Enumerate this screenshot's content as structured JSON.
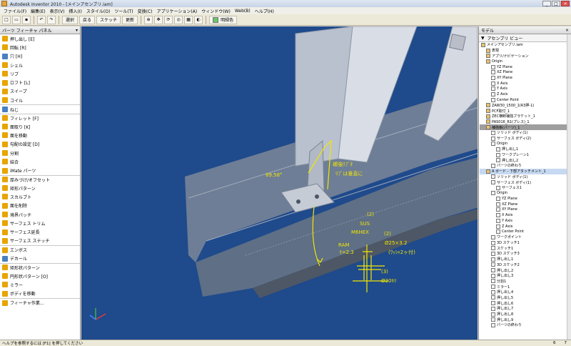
{
  "window": {
    "title": "Autodesk Inventor 2010 - [メインアセンブリ.iam]",
    "buttons": [
      "_",
      "□",
      "×"
    ]
  },
  "menu": [
    "ファイル(F)",
    "編集(E)",
    "表示(V)",
    "挿入(I)",
    "スタイル(O)",
    "ツール(T)",
    "変換(C)",
    "アプリケーション(A)",
    "ウィンドウ(W)",
    "Web(B)",
    "ヘルプ(H)"
  ],
  "toolbar": {
    "select_label": "選択",
    "back_label": "戻る",
    "sketch_label": "スケッチ",
    "update_label": "更新",
    "color_label": "明緑色"
  },
  "left_panel": {
    "title": "パーツ フィーチャ パネル",
    "tools": [
      {
        "label": "押し出し  [E]",
        "color": "#e8a400"
      },
      {
        "label": "回転  [R]",
        "color": "#e8a400"
      },
      {
        "label": "穴  [H]",
        "color": "#4a7fc1"
      },
      {
        "label": "シェル",
        "color": "#e8a400"
      },
      {
        "label": "リブ",
        "color": "#e8a400"
      },
      {
        "label": "ロフト  [L]",
        "color": "#e8a400"
      },
      {
        "label": "スイープ",
        "color": "#e8a400"
      },
      {
        "label": "コイル",
        "color": "#e8a400"
      },
      {
        "label": "ねじ",
        "color": "#4a7fc1"
      },
      {
        "label": "フィレット  [F]",
        "color": "#e8a400"
      },
      {
        "label": "面取り  [K]",
        "color": "#e8a400"
      },
      {
        "label": "面を移動",
        "color": "#e8a400"
      },
      {
        "label": "勾配の設定  [D]",
        "color": "#e8a400"
      },
      {
        "label": "分割",
        "color": "#e8a400"
      },
      {
        "label": "結合",
        "color": "#e8a400"
      },
      {
        "label": "iMate パーツ",
        "color": "#e8a400"
      },
      {
        "label": "厚みづけ/オフセット",
        "color": "#e8a400"
      },
      {
        "label": "矩形パターン",
        "color": "#e8a400"
      },
      {
        "label": "スカルプト",
        "color": "#e8a400"
      },
      {
        "label": "面を削除",
        "color": "#e8a400"
      },
      {
        "label": "境界パッチ",
        "color": "#e8a400"
      },
      {
        "label": "サーフェス トリム",
        "color": "#e8a400"
      },
      {
        "label": "サーフェス延長",
        "color": "#e8a400"
      },
      {
        "label": "サーフェス ステッチ",
        "color": "#e8a400"
      },
      {
        "label": "エンボス",
        "color": "#e8a400"
      },
      {
        "label": "デカール",
        "color": "#4a7fc1"
      },
      {
        "label": "矩形状パターン",
        "color": "#e8a400"
      },
      {
        "label": "円形状パターン  [O]",
        "color": "#e8a400"
      },
      {
        "label": "ミラー",
        "color": "#e8a400"
      },
      {
        "label": "ボディを移動",
        "color": "#e8a400"
      },
      {
        "label": "フィーチャ作業...",
        "color": "#e8a400"
      }
    ]
  },
  "right_panel": {
    "title": "モデル",
    "view_label": "アセンブリ ビュー",
    "tree": [
      {
        "label": "メインアセンブリ.iam",
        "indent": 0
      },
      {
        "label": "表現",
        "indent": 1
      },
      {
        "label": "アプリ/ナビゲーション",
        "indent": 1
      },
      {
        "label": "Origin",
        "indent": 1
      },
      {
        "label": "YZ Plane",
        "indent": 2
      },
      {
        "label": "XZ Plane",
        "indent": 2
      },
      {
        "label": "XY Plane",
        "indent": 2
      },
      {
        "label": "X Axis",
        "indent": 2
      },
      {
        "label": "Y Axis",
        "indent": 2
      },
      {
        "label": "Z Axis",
        "indent": 2
      },
      {
        "label": "Center Point",
        "indent": 2
      },
      {
        "label": "ZAW30_1500_1(R3押-1)",
        "indent": 1
      },
      {
        "label": "PCF取付_1",
        "indent": 1
      },
      {
        "label": "ZEC横断補強ブラケット_1",
        "indent": 1
      },
      {
        "label": "PAS016_R1(プレス)_1",
        "indent": 1
      },
      {
        "label": "補強板(パーツ)_1",
        "indent": 1
      },
      {
        "label": "ソリッド ボディ(1)",
        "indent": 2
      },
      {
        "label": "サーフェス ボディ(2)",
        "indent": 2
      },
      {
        "label": "Origin",
        "indent": 2
      },
      {
        "label": "押し出し1",
        "indent": 3
      },
      {
        "label": "ワークプレーン1",
        "indent": 3
      },
      {
        "label": "押し出し2",
        "indent": 3
      },
      {
        "label": "パーツの終わり",
        "indent": 2
      },
      {
        "label": "A ボード - 下部アタッチメント_1",
        "indent": 1
      },
      {
        "label": "ソリッド ボディ(1)",
        "indent": 2
      },
      {
        "label": "サーフェス ボディ(1)",
        "indent": 2
      },
      {
        "label": "サーフェス1",
        "indent": 3
      },
      {
        "label": "Origin",
        "indent": 2
      },
      {
        "label": "YZ Plane",
        "indent": 3
      },
      {
        "label": "XZ Plane",
        "indent": 3
      },
      {
        "label": "XY Plane",
        "indent": 3
      },
      {
        "label": "X Axis",
        "indent": 3
      },
      {
        "label": "Y Axis",
        "indent": 3
      },
      {
        "label": "Z Axis",
        "indent": 3
      },
      {
        "label": "Center Point",
        "indent": 3
      },
      {
        "label": "ワークポイント",
        "indent": 2
      },
      {
        "label": "3D スケッチ1",
        "indent": 2
      },
      {
        "label": "スケッチ1",
        "indent": 2
      },
      {
        "label": "3D スケッチ3",
        "indent": 2
      },
      {
        "label": "押し出し1",
        "indent": 2
      },
      {
        "label": "3D スケッチ2",
        "indent": 2
      },
      {
        "label": "押し出し2",
        "indent": 2
      },
      {
        "label": "押し出し3",
        "indent": 2
      },
      {
        "label": "分割1",
        "indent": 2
      },
      {
        "label": "ミラー1",
        "indent": 2
      },
      {
        "label": "押し出し4",
        "indent": 2
      },
      {
        "label": "押し出し5",
        "indent": 2
      },
      {
        "label": "押し出し6",
        "indent": 2
      },
      {
        "label": "押し出し7",
        "indent": 2
      },
      {
        "label": "押し出し8",
        "indent": 2
      },
      {
        "label": "押し出し9",
        "indent": 2
      },
      {
        "label": "パーツの終わり",
        "indent": 2
      }
    ]
  },
  "annotations": {
    "angle": "89.58°",
    "rib_note_1": "補強ﾘﾌﾞﾀ",
    "rib_note_2": "ﾘﾌﾞは垂直に",
    "bolt": "M6HEX",
    "sus": "SUS",
    "plate": "Ø25×3.2",
    "washer_note": "(ﾜｯｼｬ2ヶ付)",
    "hole": "Ø20ｷﾘ",
    "ram": "RAM",
    "t23": "t=2.3",
    "qty": "(2)",
    "qty2": "(2)",
    "qty3": "(3)"
  },
  "status": {
    "help": "ヘルプを参照するには [F1] を押してください",
    "num1": "6",
    "num2": "7"
  },
  "colors": {
    "viewport": "#1f4a8c",
    "annotation": "#f2e600"
  }
}
